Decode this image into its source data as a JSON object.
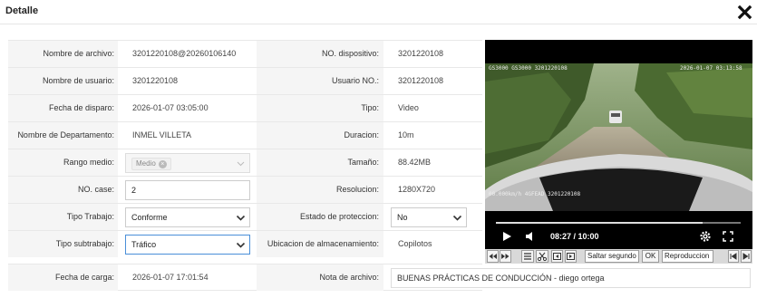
{
  "dialog": {
    "title": "Detalle"
  },
  "left": [
    {
      "label": "Nombre de archivo:",
      "value": "3201220108@20260106140"
    },
    {
      "label": "Nombre de usuario:",
      "value": "3201220108"
    },
    {
      "label": "Fecha de disparo:",
      "value": "2026-01-07 03:05:00"
    },
    {
      "label": "Nombre de Departamento:",
      "value": "INMEL VILLETA"
    },
    {
      "label": "Rango medio:",
      "tag": "Medio"
    },
    {
      "label": "NO. case:",
      "input": "2"
    },
    {
      "label": "Tipo Trabajo:",
      "select": "Conforme"
    },
    {
      "label": "Tipo subtrabajo:",
      "select": "Tráfico"
    },
    {
      "label": "Fecha de carga:",
      "value": "2026-01-07 17:01:54"
    }
  ],
  "right": [
    {
      "label": "NO. dispositivo:",
      "value": "3201220108"
    },
    {
      "label": "Usuario NO.:",
      "value": "3201220108"
    },
    {
      "label": "Tipo:",
      "value": "Video"
    },
    {
      "label": "Duracion:",
      "value": "10m"
    },
    {
      "label": "Tamaño:",
      "value": "88.42MB"
    },
    {
      "label": "Resolucion:",
      "value": "1280X720"
    },
    {
      "label": "Estado de proteccion:",
      "select": "No"
    },
    {
      "label": "Ubicacion de almacenamiento:",
      "value": "Copilotos"
    }
  ],
  "note": {
    "label": "Nota de archivo:",
    "value": "BUENAS PRÁCTICAS DE CONDUCCIÓN - diego ortega"
  },
  "video": {
    "osd_top_left": "GS3000 GS3000 3201220108",
    "osd_top_right": "2026-01-07 03:13:58",
    "osd_bottom_left": "00.000km/h 4GFEAD 3201220108",
    "time": "08:27 / 10:00",
    "progress": 0.845
  },
  "playback_bar": {
    "skip_label": "Saltar segundo",
    "ok_label": "OK",
    "play_label": "Reproduccion"
  }
}
